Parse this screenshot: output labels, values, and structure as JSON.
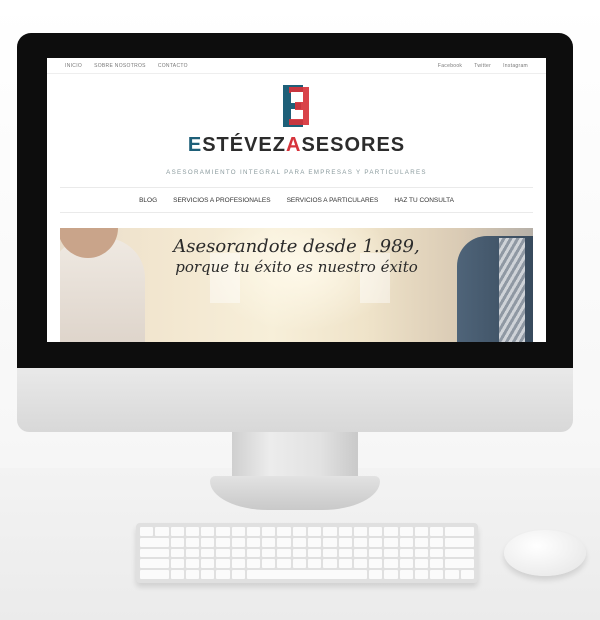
{
  "site": {
    "topbar": {
      "left_links": [
        "INICIO",
        "SOBRE NOSOTROS",
        "CONTACTO"
      ],
      "right_links": [
        "Facebook",
        "Twitter",
        "Instagram"
      ]
    },
    "brand": {
      "part_e": "E",
      "part_stevez": "STÉVEZ",
      "part_a": "A",
      "part_sesores": "SESORES",
      "tagline": "ASESORAMIENTO INTEGRAL PARA EMPRESAS Y PARTICULARES"
    },
    "nav": [
      "BLOG",
      "SERVICIOS A PROFESIONALES",
      "SERVICIOS A PARTICULARES",
      "HAZ TU CONSULTA"
    ],
    "hero": {
      "line1": "Asesorandote desde 1.989,",
      "line2": "porque tu éxito es nuestro éxito"
    }
  },
  "colors": {
    "brand_blue": "#1e5f78",
    "brand_red": "#d6333b"
  }
}
